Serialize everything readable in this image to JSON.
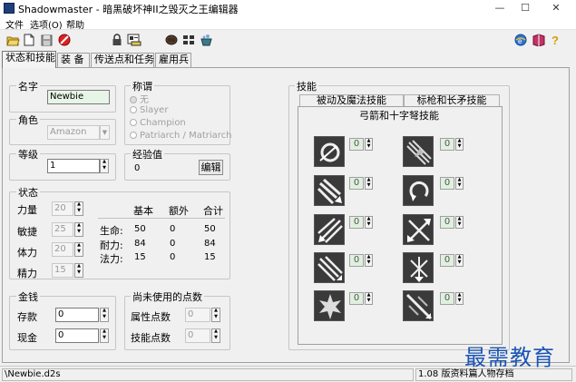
{
  "window": {
    "title": "Shadowmaster - 暗黑破坏神II之毁灭之王编辑器",
    "controls": {
      "minimize": "—",
      "maximize": "☐",
      "close": "✕"
    }
  },
  "menu": [
    "文件",
    "选项(O)",
    "帮助"
  ],
  "toolbar": {
    "left": [
      "open-folder-icon",
      "new-file-icon",
      "save-disk-icon",
      "cancel-icon",
      "lock-icon",
      "character-card-icon",
      "fist-icon",
      "text-block-icon",
      "cauldron-icon"
    ],
    "right": [
      "ie-globe-icon",
      "book-icon",
      "help-question-icon"
    ]
  },
  "tabs": [
    "状态和技能",
    "装 备",
    "传送点和任务",
    "雇用兵"
  ],
  "name_section": {
    "label": "名字",
    "value": "Newbie"
  },
  "title_section": {
    "label": "称谓",
    "options": [
      "无",
      "Slayer",
      "Champion",
      "Patriarch / Matriarch"
    ],
    "selected": "无"
  },
  "class_section": {
    "label": "角色",
    "value": "Amazon"
  },
  "level_section": {
    "label": "等级",
    "value": "1"
  },
  "exp_section": {
    "label": "经验值",
    "value": "0",
    "edit_button": "编辑"
  },
  "stats_section": {
    "label": "状态",
    "attributes": [
      {
        "label": "力量",
        "value": "20"
      },
      {
        "label": "敏捷",
        "value": "25"
      },
      {
        "label": "体力",
        "value": "20"
      },
      {
        "label": "精力",
        "value": "15"
      }
    ],
    "headers": [
      "基本",
      "额外",
      "合计"
    ],
    "rows": [
      {
        "label": "生命:",
        "base": "50",
        "extra": "0",
        "total": "50"
      },
      {
        "label": "耐力:",
        "base": "84",
        "extra": "0",
        "total": "84"
      },
      {
        "label": "法力:",
        "base": "15",
        "extra": "0",
        "total": "15"
      }
    ]
  },
  "gold_section": {
    "label": "金钱",
    "items": [
      {
        "label": "存款",
        "value": "0"
      },
      {
        "label": "现金",
        "value": "0"
      }
    ]
  },
  "unused_section": {
    "label": "尚未使用的点数",
    "items": [
      {
        "label": "属性点数",
        "value": "0"
      },
      {
        "label": "技能点数",
        "value": "0"
      }
    ]
  },
  "skills_section": {
    "label": "技能",
    "tabs": [
      "被动及魔法技能",
      "标枪和长矛技能",
      "弓箭和十字弩技能"
    ],
    "active_tab": "弓箭和十字弩技能",
    "skills": [
      {
        "icon": "magic-arrow-skill-icon",
        "value": "0"
      },
      {
        "icon": "fire-arrow-skill-icon",
        "value": "0"
      },
      {
        "icon": "cold-arrow-skill-icon",
        "value": "0"
      },
      {
        "icon": "multiple-shot-skill-icon",
        "value": "0"
      },
      {
        "icon": "exploding-arrow-skill-icon",
        "value": "0"
      },
      {
        "icon": "ice-arrow-skill-icon",
        "value": "0"
      },
      {
        "icon": "guided-arrow-skill-icon",
        "value": "0"
      },
      {
        "icon": "immolation-arrow-skill-icon",
        "value": "0"
      },
      {
        "icon": "strafe-skill-icon",
        "value": "0"
      },
      {
        "icon": "freezing-arrow-skill-icon",
        "value": "0"
      }
    ]
  },
  "statusbar": {
    "file": "\\Newbie.d2s",
    "version": "1.08 版资料篇人物存档"
  },
  "watermark": "最需教育"
}
